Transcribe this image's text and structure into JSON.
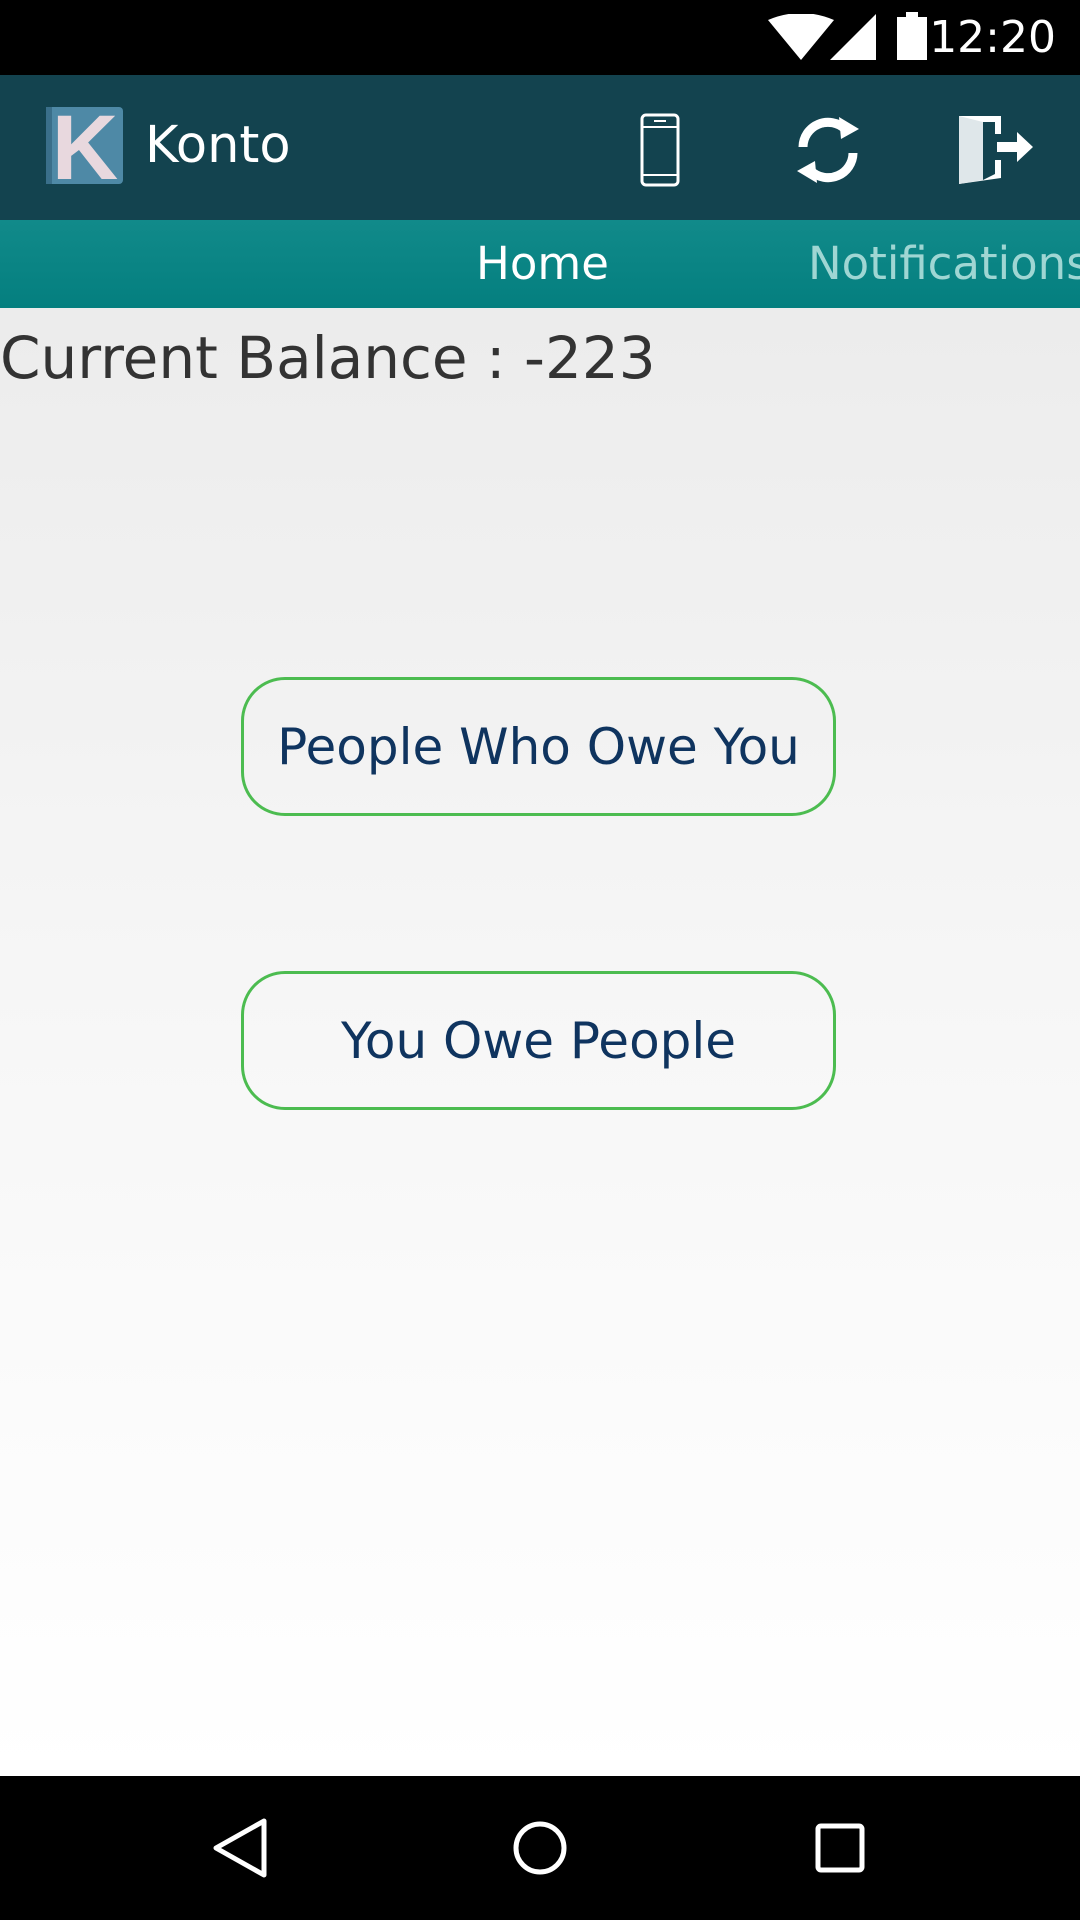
{
  "status_bar": {
    "time": "12:20",
    "icons": [
      "wifi-icon",
      "cell-signal-icon",
      "battery-icon"
    ]
  },
  "toolbar": {
    "logo_letter": "K",
    "title": "Konto",
    "actions": [
      "device-icon",
      "sync-icon",
      "logout-icon"
    ]
  },
  "tabs": [
    {
      "label": "Home",
      "active": true
    },
    {
      "label": "Notifications",
      "active": false
    }
  ],
  "main": {
    "balance_text": "Current Balance : -223",
    "buttons": {
      "owe_you": "People Who Owe You",
      "you_owe": "You Owe People"
    }
  },
  "nav_bar": {
    "icons": [
      "back-icon",
      "home-icon",
      "recents-icon"
    ]
  },
  "colors": {
    "toolbar": "#13434f",
    "tab_bar": "#047f7f",
    "button_border": "#4cbc50",
    "button_text": "#0f345f",
    "tab_active": "#ffffff",
    "tab_inactive": "#9fd6d3"
  }
}
